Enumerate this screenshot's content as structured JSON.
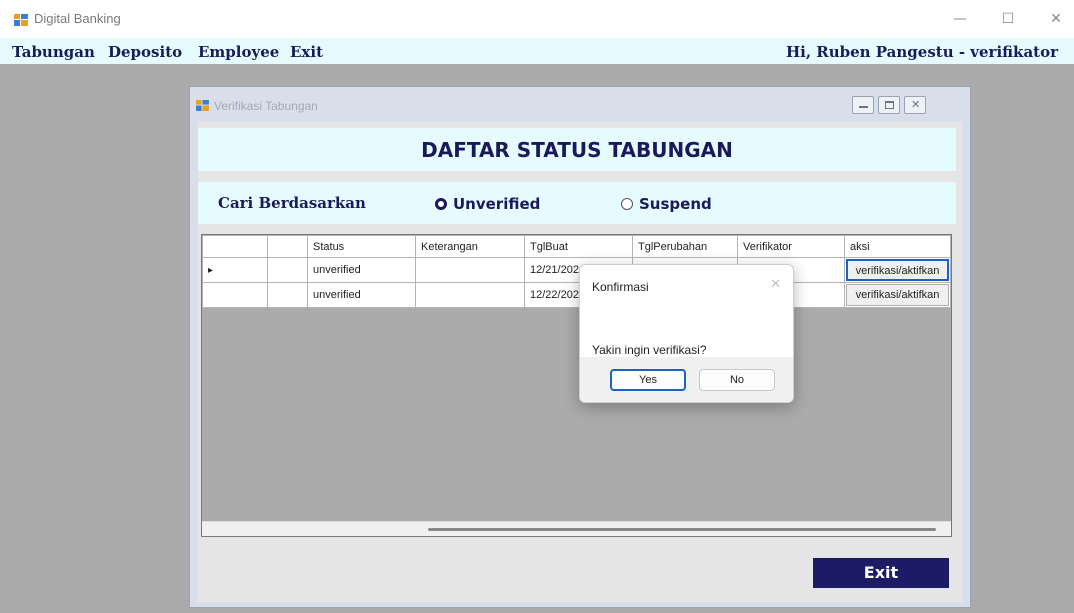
{
  "app": {
    "title": "Digital Banking",
    "window_controls": [
      "—",
      "☐",
      "✕"
    ]
  },
  "menu": {
    "items": [
      "Tabungan",
      "Deposito",
      "Employee",
      "Exit"
    ],
    "greeting": "Hi, Ruben Pangestu - verifikator"
  },
  "child": {
    "title": "Verifikasi Tabungan",
    "heading": "DAFTAR STATUS TABUNGAN",
    "search_label": "Cari Berdasarkan",
    "radios": [
      {
        "label": "Unverified",
        "selected": true
      },
      {
        "label": "Suspend",
        "selected": false
      }
    ],
    "exit_label": "Exit"
  },
  "grid": {
    "columns": [
      "",
      "",
      "Status",
      "Keterangan",
      "TglBuat",
      "TglPerubahan",
      "Verifikator",
      "aksi"
    ],
    "rows": [
      {
        "indicator": "▸",
        "id": "",
        "status": "unverified",
        "keterangan": "",
        "tglbuat": "12/21/202",
        "tglperubahan": "",
        "verifikator": "",
        "aksi": "verifikasi/aktifkan"
      },
      {
        "indicator": "",
        "id": "",
        "status": "unverified",
        "keterangan": "",
        "tglbuat": "12/22/202",
        "tglperubahan": "",
        "verifikator": "",
        "aksi": "verifikasi/aktifkan"
      }
    ]
  },
  "dialog": {
    "title": "Konfirmasi",
    "close": "✕",
    "message": "Yakin ingin verifikasi?",
    "yes_label": "Yes",
    "no_label": "No"
  },
  "colors": {
    "accent_navy": "#1b1b66",
    "panel_cyan": "#e6fbfd",
    "focus_blue": "#1a62c5"
  }
}
